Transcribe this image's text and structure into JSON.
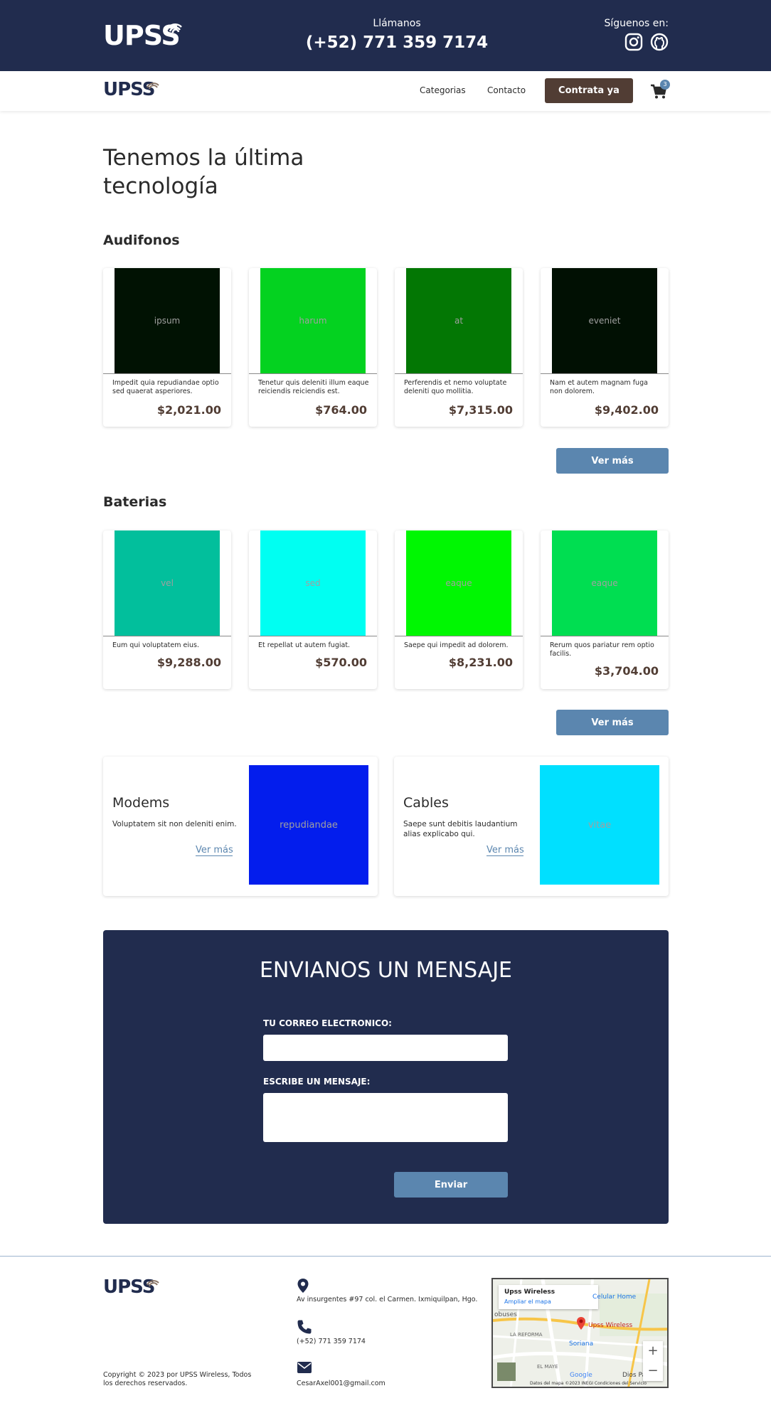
{
  "topbar": {
    "logo": "UPSS",
    "call_label": "Llámanos",
    "phone": "(+52) 771 359 7174",
    "follow_label": "Síguenos en:"
  },
  "navbar": {
    "logo": "UPSS",
    "links": [
      "Categorias",
      "Contacto"
    ],
    "cta": "Contrata ya",
    "cart_count": "3"
  },
  "hero": {
    "title": "Tenemos la última tecnología"
  },
  "sections": [
    {
      "title": "Audifonos",
      "more": "Ver más",
      "products": [
        {
          "image_text": "ipsum",
          "color": "#011203",
          "desc": "Impedit quia repudiandae optio sed quaerat asperiores.",
          "price": "$2,021.00"
        },
        {
          "image_text": "harum",
          "color": "#04d220",
          "desc": "Tenetur quis deleniti illum eaque reiciendis reiciendis est.",
          "price": "$764.00"
        },
        {
          "image_text": "at",
          "color": "#037704",
          "desc": "Perferendis et nemo voluptate deleniti quo mollitia.",
          "price": "$7,315.00"
        },
        {
          "image_text": "eveniet",
          "color": "#011003",
          "desc": "Nam et autem magnam fuga non dolorem.",
          "price": "$9,402.00"
        }
      ]
    },
    {
      "title": "Baterias",
      "more": "Ver más",
      "products": [
        {
          "image_text": "vel",
          "color": "#02bf9c",
          "desc": "Eum qui voluptatem eius.",
          "price": "$9,288.00"
        },
        {
          "image_text": "sed",
          "color": "#00fff2",
          "desc": "Et repellat ut autem fugiat.",
          "price": "$570.00"
        },
        {
          "image_text": "eaque",
          "color": "#00f702",
          "desc": "Saepe qui impedit ad dolorem.",
          "price": "$8,231.00"
        },
        {
          "image_text": "eaque",
          "color": "#00de51",
          "desc": "Rerum quos pariatur rem optio facilis.",
          "price": "$3,704.00"
        }
      ]
    }
  ],
  "categories": [
    {
      "title": "Modems",
      "desc": "Voluptatem sit non deleniti enim.",
      "link": "Ver más",
      "image_text": "repudiandae",
      "color": "#031ded"
    },
    {
      "title": "Cables",
      "desc": "Saepe sunt debitis laudantium alias explicabo qui.",
      "link": "Ver más",
      "image_text": "vitae",
      "color": "#00e0ff"
    }
  ],
  "contact": {
    "title": "ENVIANOS UN MENSAJE",
    "email_label": "TU CORREO ELECTRONICO:",
    "message_label": "ESCRIBE UN MENSAJE:",
    "send": "Enviar"
  },
  "footer": {
    "logo": "UPSS",
    "copyright": "Copyright © 2023 por UPSS Wireless, Todos los derechos reservados.",
    "address": "Av insurgentes #97 col. el Carmen. Ixmiquilpan, Hgo.",
    "phone": "(+52) 771 359 7174",
    "email": "CesarAxel001@gmail.com",
    "map": {
      "place": "Upss Wireless",
      "enlarge": "Ampliar el mapa",
      "labels": [
        "Celular Home",
        "Upss Wireless",
        "Soriana",
        "LA REFORMA",
        "EL MAYE",
        "Dios Padre",
        "Google",
        "obuses"
      ],
      "footer": "Datos del mapa ©2023 INEGI   Condiciones del Servicio"
    }
  },
  "colors": {
    "navy": "#212c4e",
    "brown": "#513d34",
    "steel_blue": "#5b86af"
  }
}
